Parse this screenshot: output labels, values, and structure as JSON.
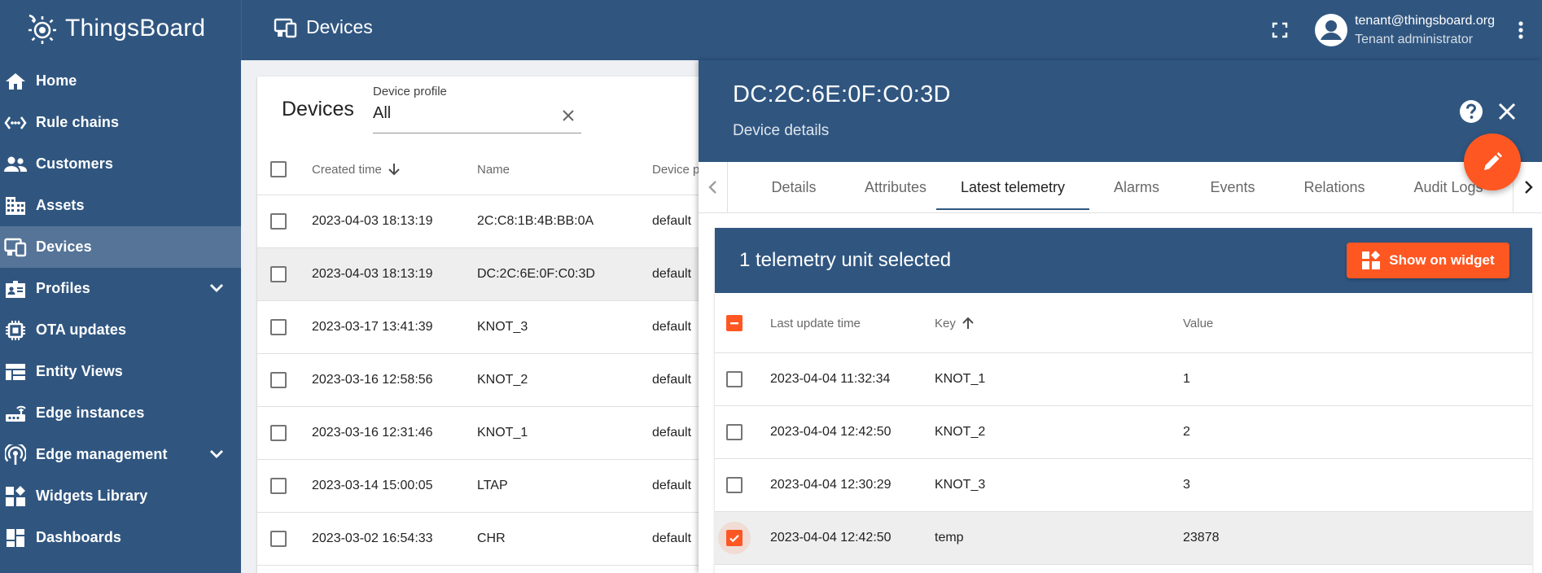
{
  "app": {
    "logo_text": "ThingsBoard",
    "page_heading": "Devices"
  },
  "user": {
    "email": "tenant@thingsboard.org",
    "role": "Tenant administrator"
  },
  "sidebar": {
    "items": [
      {
        "label": "Home",
        "icon": "home-icon"
      },
      {
        "label": "Rule chains",
        "icon": "rule-chains-icon"
      },
      {
        "label": "Customers",
        "icon": "customers-icon"
      },
      {
        "label": "Assets",
        "icon": "assets-icon"
      },
      {
        "label": "Devices",
        "icon": "devices-icon",
        "active": true
      },
      {
        "label": "Profiles",
        "icon": "profiles-icon",
        "expandable": true
      },
      {
        "label": "OTA updates",
        "icon": "ota-updates-icon"
      },
      {
        "label": "Entity Views",
        "icon": "entity-views-icon"
      },
      {
        "label": "Edge instances",
        "icon": "edge-instances-icon"
      },
      {
        "label": "Edge management",
        "icon": "edge-management-icon",
        "expandable": true
      },
      {
        "label": "Widgets Library",
        "icon": "widgets-library-icon"
      },
      {
        "label": "Dashboards",
        "icon": "dashboards-icon"
      }
    ]
  },
  "devices_card": {
    "title": "Devices",
    "filter_label": "Device profile",
    "filter_value": "All",
    "columns": [
      "Created time",
      "Name",
      "Device p"
    ],
    "rows": [
      {
        "created": "2023-04-03 18:13:19",
        "name": "2C:C8:1B:4B:BB:0A",
        "profile": "default"
      },
      {
        "created": "2023-04-03 18:13:19",
        "name": "DC:2C:6E:0F:C0:3D",
        "profile": "default",
        "selected": true
      },
      {
        "created": "2023-03-17 13:41:39",
        "name": "KNOT_3",
        "profile": "default"
      },
      {
        "created": "2023-03-16 12:58:56",
        "name": "KNOT_2",
        "profile": "default"
      },
      {
        "created": "2023-03-16 12:31:46",
        "name": "KNOT_1",
        "profile": "default"
      },
      {
        "created": "2023-03-14 15:00:05",
        "name": "LTAP",
        "profile": "default"
      },
      {
        "created": "2023-03-02 16:54:33",
        "name": "CHR",
        "profile": "default"
      }
    ]
  },
  "details": {
    "title": "DC:2C:6E:0F:C0:3D",
    "subtitle": "Device details",
    "tabs": [
      "Details",
      "Attributes",
      "Latest telemetry",
      "Alarms",
      "Events",
      "Relations",
      "Audit Logs"
    ],
    "active_tab": "Latest telemetry",
    "selection_text": "1 telemetry unit selected",
    "show_button": "Show on widget",
    "columns": [
      "Last update time",
      "Key",
      "Value"
    ],
    "rows": [
      {
        "time": "2023-04-04 11:32:34",
        "key": "KNOT_1",
        "value": "1",
        "checked": false
      },
      {
        "time": "2023-04-04 12:42:50",
        "key": "KNOT_2",
        "value": "2",
        "checked": false
      },
      {
        "time": "2023-04-04 12:30:29",
        "key": "KNOT_3",
        "value": "3",
        "checked": false
      },
      {
        "time": "2023-04-04 12:42:50",
        "key": "temp",
        "value": "23878",
        "checked": true
      }
    ]
  },
  "colors": {
    "primary": "#305680",
    "accent": "#ff5722"
  }
}
